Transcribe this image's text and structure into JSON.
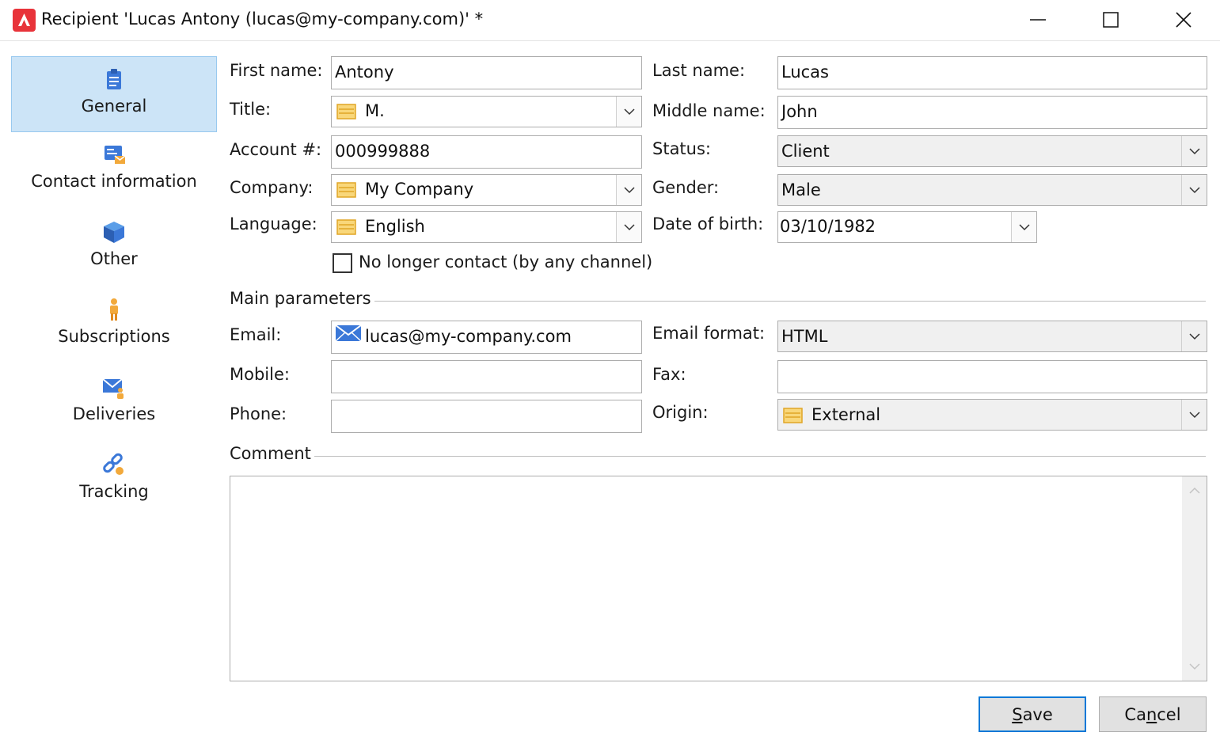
{
  "window": {
    "title": "Recipient 'Lucas Antony (lucas@my-company.com)' *",
    "accent_color": "#0078d7",
    "app_icon_color": "#e8333a"
  },
  "sidebar": {
    "items": [
      {
        "label": "General",
        "icon": "clipboard-icon",
        "selected": true
      },
      {
        "label": "Contact information",
        "icon": "contact-card-icon"
      },
      {
        "label": "Other",
        "icon": "cube-icon"
      },
      {
        "label": "Subscriptions",
        "icon": "person-icon"
      },
      {
        "label": "Deliveries",
        "icon": "envelope-person-icon"
      },
      {
        "label": "Tracking",
        "icon": "link-icon"
      }
    ]
  },
  "form": {
    "first_name_label": "First name:",
    "first_name": "Antony",
    "last_name_label": "Last name:",
    "last_name": "Lucas",
    "title_label": "Title:",
    "title": "M.",
    "middle_name_label": "Middle name:",
    "middle_name": "John",
    "account_label": "Account #:",
    "account": "000999888",
    "status_label": "Status:",
    "status": "Client",
    "company_label": "Company:",
    "company": "My Company",
    "gender_label": "Gender:",
    "gender": "Male",
    "language_label": "Language:",
    "language": "English",
    "dob_label": "Date of birth:",
    "dob": "03/10/1982",
    "no_contact_label": "No longer contact (by any channel)",
    "no_contact_checked": false
  },
  "main_parameters": {
    "section_title": "Main parameters",
    "email_label": "Email:",
    "email": "lucas@my-company.com",
    "email_format_label": "Email format:",
    "email_format": "HTML",
    "mobile_label": "Mobile:",
    "mobile": "",
    "fax_label": "Fax:",
    "fax": "",
    "phone_label": "Phone:",
    "phone": "",
    "origin_label": "Origin:",
    "origin": "External"
  },
  "comment": {
    "section_title": "Comment",
    "value": ""
  },
  "buttons": {
    "save_mnemonic": "S",
    "save_rest": "ave",
    "cancel_prefix": "Ca",
    "cancel_mnemonic": "n",
    "cancel_rest": "cel"
  }
}
